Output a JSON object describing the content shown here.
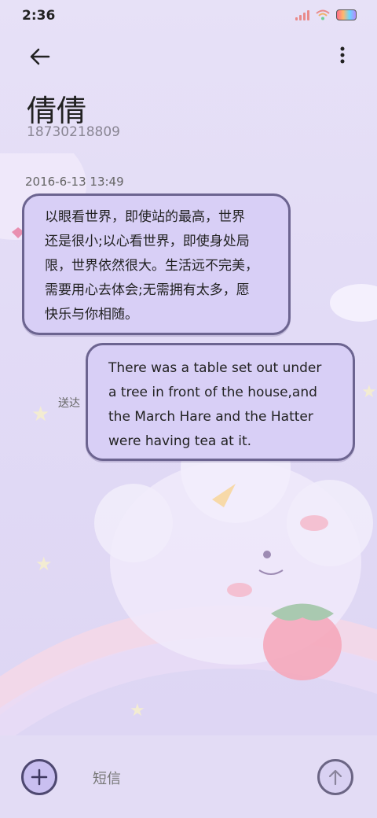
{
  "status_bar": {
    "time": "2:36"
  },
  "header": {
    "contact_name": "倩倩",
    "contact_number": "18730218809"
  },
  "messages": [
    {
      "direction": "incoming",
      "timestamp": "2016-6-13 13:49",
      "lines": [
        "以眼看世界，即使站的最高，世界",
        "还是很小;以心看世界，即使身处局",
        "限，世界依然很大。生活远不完美，",
        "需要用心去体会;无需拥有太多，愿",
        "快乐与你相随。"
      ]
    },
    {
      "direction": "outgoing",
      "status": "送达",
      "lines": [
        "There was a table set out under",
        "a tree in front of the house,and",
        "the March Hare and the Hatter",
        "were having tea at it."
      ]
    }
  ],
  "input_bar": {
    "placeholder": "短信"
  },
  "icons": {
    "back": "arrow-left-icon",
    "more": "more-vertical-icon",
    "signal": "signal-icon",
    "wifi": "wifi-icon",
    "battery": "battery-icon",
    "add": "plus-icon",
    "send": "arrow-up-icon"
  },
  "colors": {
    "bubble_fill": "#d8cff6",
    "bubble_border": "#6c6490",
    "background": "#e4ddf6"
  }
}
